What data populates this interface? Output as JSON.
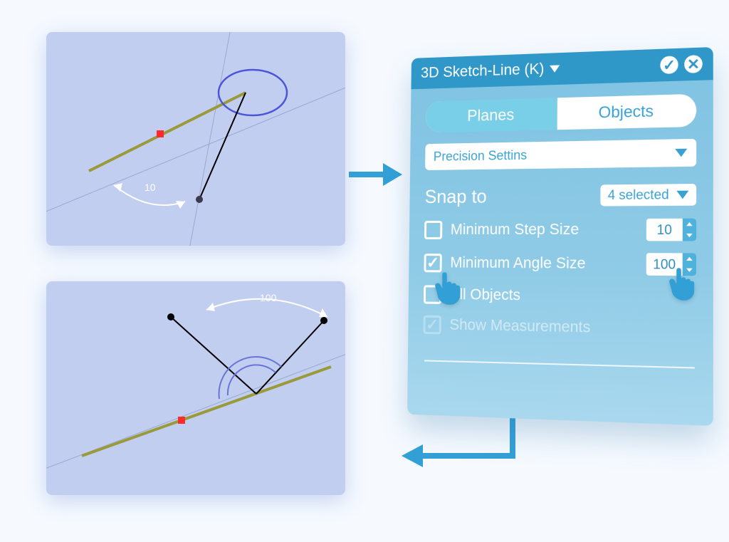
{
  "panel": {
    "title": "3D Sketch-Line (K)",
    "tabs": {
      "planes": "Planes",
      "objects": "Objects",
      "active": "planes"
    },
    "section_select": "Precision Settins",
    "snap_label": "Snap to",
    "snap_value": "4 selected",
    "options": {
      "min_step": {
        "label": "Minimum Step Size",
        "checked": false,
        "value": "10"
      },
      "min_angle": {
        "label": "Minimum Angle Size",
        "checked": true,
        "value": "100"
      },
      "all_objects": {
        "label": "All Objects",
        "checked": false
      },
      "show_meas": {
        "label": "Show Measurements",
        "checked": true,
        "disabled": true
      }
    }
  },
  "sketches": {
    "top": {
      "measurement": "10"
    },
    "bottom": {
      "measurement": "100"
    }
  },
  "colors": {
    "accent": "#32a0d6",
    "panel_bg": "#7fc2e2",
    "viewport_bg": "#c1cef0"
  }
}
